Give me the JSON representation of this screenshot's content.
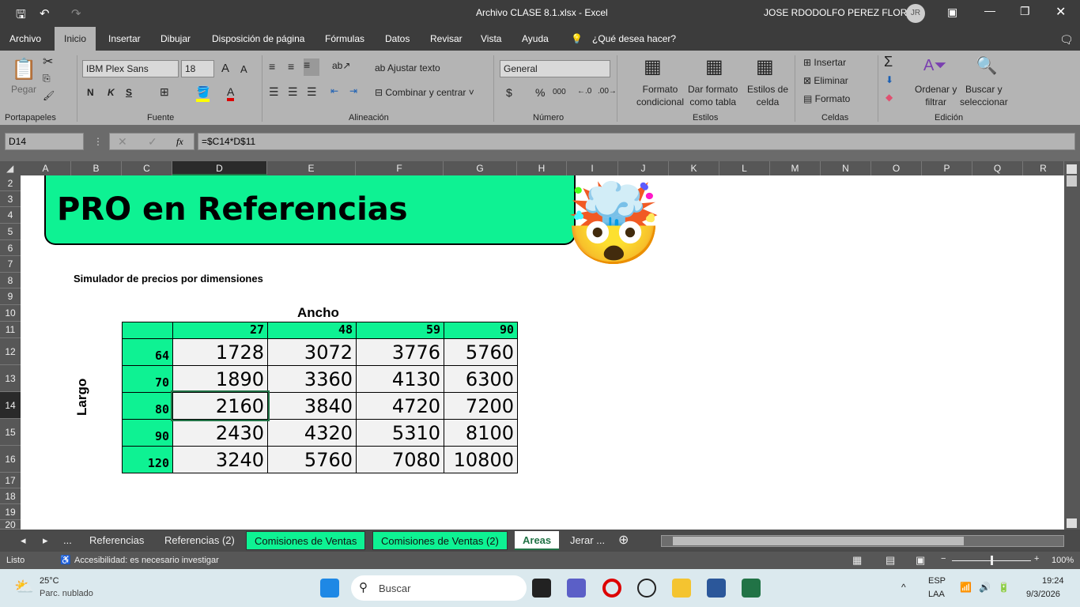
{
  "title": {
    "filename": "Archivo CLASE 8.1.xlsx  -  Excel",
    "user": "JOSE RDODOLFO PEREZ FLORES",
    "initials": "JR"
  },
  "ribbon_tabs": [
    "Archivo",
    "Inicio",
    "Insertar",
    "Dibujar",
    "Disposición de página",
    "Fórmulas",
    "Datos",
    "Revisar",
    "Vista",
    "Ayuda"
  ],
  "tell_me": "¿Qué desea hacer?",
  "ribbon": {
    "paste": "Pegar",
    "font": "IBM Plex Sans",
    "size": "18",
    "bold": "N",
    "italic": "K",
    "underline": "S",
    "wrap": "Ajustar texto",
    "merge": "Combinar y centrar",
    "numfmt": "General",
    "currency": "$",
    "percent": "%",
    "thousands": "000",
    "cond1": "Formato",
    "cond2": "condicional",
    "table1": "Dar formato",
    "table2": "como tabla",
    "styles1": "Estilos de",
    "styles2": "celda",
    "insert": "Insertar",
    "delete": "Eliminar",
    "format": "Formato",
    "sort1": "Ordenar y",
    "sort2": "filtrar",
    "find1": "Buscar y",
    "find2": "seleccionar",
    "groups": [
      "Portapapeles",
      "Fuente",
      "Alineación",
      "Número",
      "Estilos",
      "Celdas",
      "Edición"
    ]
  },
  "formula_bar": {
    "name_box": "D14",
    "formula": "=$C14*D$11",
    "fx": "fx"
  },
  "columns": [
    "A",
    "B",
    "C",
    "D",
    "E",
    "F",
    "G",
    "H",
    "I",
    "J",
    "K",
    "L",
    "M",
    "N",
    "O",
    "P",
    "Q",
    "R"
  ],
  "rows": [
    "2",
    "3",
    "4",
    "5",
    "6",
    "7",
    "8",
    "9",
    "10",
    "11",
    "12",
    "13",
    "14",
    "15",
    "16",
    "17",
    "18",
    "19",
    "20"
  ],
  "sheet": {
    "banner": "PRO en Referencias",
    "subtitle": "Simulador de precios por dimensiones",
    "ancho": "Ancho",
    "largo": "Largo",
    "widths": [
      "27",
      "48",
      "59",
      "90"
    ],
    "lengths": [
      "64",
      "70",
      "80",
      "90",
      "120"
    ],
    "values": [
      [
        "1728",
        "3072",
        "3776",
        "5760"
      ],
      [
        "1890",
        "3360",
        "4130",
        "6300"
      ],
      [
        "2160",
        "3840",
        "4720",
        "7200"
      ],
      [
        "2430",
        "4320",
        "5310",
        "8100"
      ],
      [
        "3240",
        "5760",
        "7080",
        "10800"
      ]
    ]
  },
  "sheet_tabs": [
    "Referencias",
    "Referencias (2)",
    "Comisiones de Ventas",
    "Comisiones de Ventas (2)",
    "Areas",
    "Jerar ..."
  ],
  "status": {
    "ready": "Listo",
    "accessibility": "Accesibilidad: es necesario investigar",
    "zoom": "100%"
  },
  "taskbar": {
    "temp": "25°C",
    "weather": "Parc. nublado",
    "search": "Buscar",
    "lang1": "ESP",
    "lang2": "LAA",
    "time": "19:24",
    "date": "9/3/2026"
  },
  "colors": {
    "accent_green": "#0ef293",
    "excel_green": "#217346"
  }
}
